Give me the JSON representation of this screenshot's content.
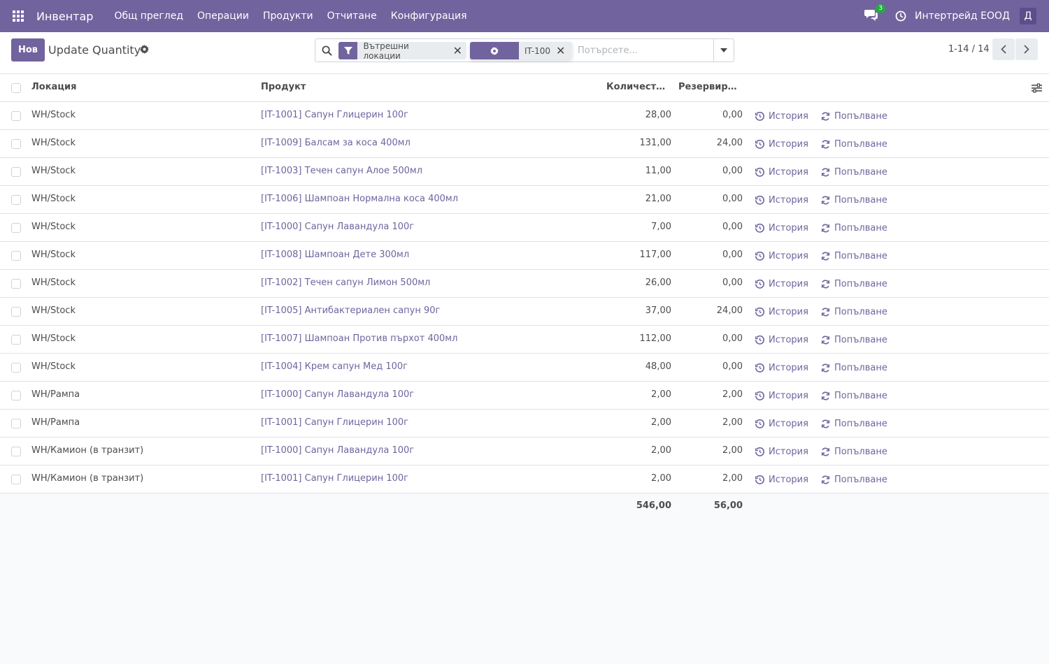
{
  "navbar": {
    "app_name": "Инвентар",
    "menu": [
      "Общ преглед",
      "Операции",
      "Продукти",
      "Отчитане",
      "Конфигурация"
    ],
    "messages_count": "3",
    "company": "Интертрейд ЕООД",
    "avatar_letter": "Д",
    "color": "#71639e"
  },
  "control_panel": {
    "new_label": "Нов",
    "title": "Update Quantity",
    "facets": [
      {
        "icon": "filter-icon",
        "label": "Вътрешни локации"
      },
      {
        "icon": "gear-icon",
        "label": "IT-100"
      }
    ],
    "search_placeholder": "Потърсете...",
    "pager": "1-14 / 14"
  },
  "list": {
    "columns": [
      "Локация",
      "Продукт",
      "Количеств...",
      "Резервира..."
    ],
    "action_history": "История",
    "action_refill": "Попълване",
    "rows": [
      {
        "location": "WH/Stock",
        "product": "[IT-1001] Сапун Глицерин 100г",
        "qty": "28,00",
        "reserved": "0,00"
      },
      {
        "location": "WH/Stock",
        "product": "[IT-1009] Балсам за коса 400мл",
        "qty": "131,00",
        "reserved": "24,00"
      },
      {
        "location": "WH/Stock",
        "product": "[IT-1003] Течен сапун Алое 500мл",
        "qty": "11,00",
        "reserved": "0,00"
      },
      {
        "location": "WH/Stock",
        "product": "[IT-1006] Шампоан Нормална коса 400мл",
        "qty": "21,00",
        "reserved": "0,00"
      },
      {
        "location": "WH/Stock",
        "product": "[IT-1000] Сапун Лавандула 100г",
        "qty": "7,00",
        "reserved": "0,00"
      },
      {
        "location": "WH/Stock",
        "product": "[IT-1008] Шампоан Дете 300мл",
        "qty": "117,00",
        "reserved": "0,00"
      },
      {
        "location": "WH/Stock",
        "product": "[IT-1002] Течен сапун Лимон 500мл",
        "qty": "26,00",
        "reserved": "0,00"
      },
      {
        "location": "WH/Stock",
        "product": "[IT-1005] Антибактериален сапун 90г",
        "qty": "37,00",
        "reserved": "24,00"
      },
      {
        "location": "WH/Stock",
        "product": "[IT-1007] Шампоан Против пърхот 400мл",
        "qty": "112,00",
        "reserved": "0,00"
      },
      {
        "location": "WH/Stock",
        "product": "[IT-1004] Крем сапун Мед 100г",
        "qty": "48,00",
        "reserved": "0,00"
      },
      {
        "location": "WH/Рампа",
        "product": "[IT-1000] Сапун Лавандула 100г",
        "qty": "2,00",
        "reserved": "2,00"
      },
      {
        "location": "WH/Рампа",
        "product": "[IT-1001] Сапун Глицерин 100г",
        "qty": "2,00",
        "reserved": "2,00"
      },
      {
        "location": "WH/Камион (в транзит)",
        "product": "[IT-1000] Сапун Лавандула 100г",
        "qty": "2,00",
        "reserved": "2,00"
      },
      {
        "location": "WH/Камион (в транзит)",
        "product": "[IT-1001] Сапун Глицерин 100г",
        "qty": "2,00",
        "reserved": "2,00"
      }
    ],
    "totals": {
      "qty": "546,00",
      "reserved": "56,00"
    }
  }
}
